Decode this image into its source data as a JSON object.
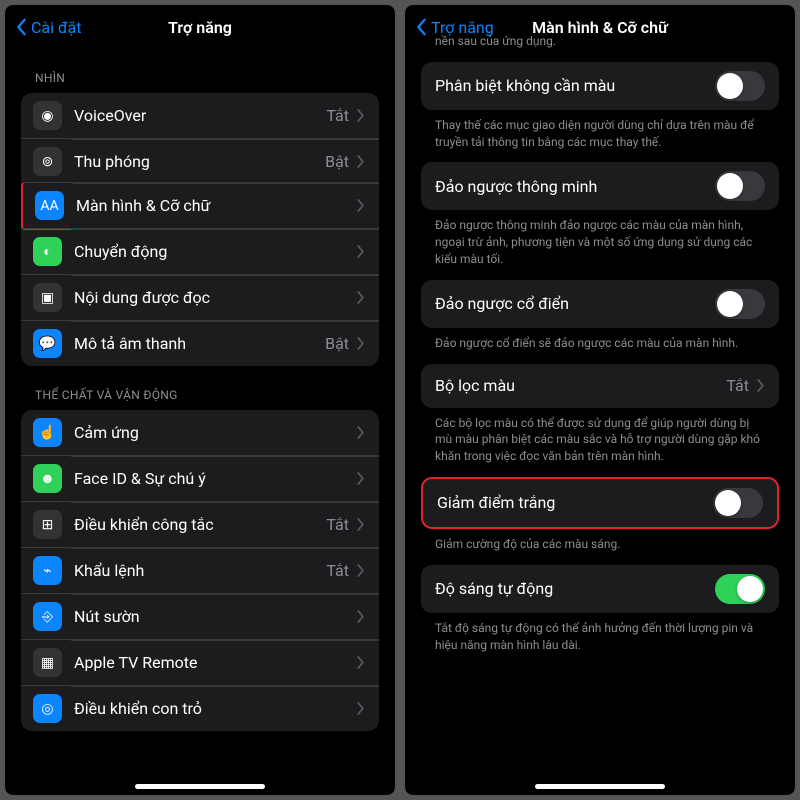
{
  "left": {
    "back": "Cài đặt",
    "title": "Trợ năng",
    "section1": "NHÌN",
    "items1": [
      {
        "label": "VoiceOver",
        "value": "Tắt",
        "iconColor": "#333"
      },
      {
        "label": "Thu phóng",
        "value": "Bật",
        "iconColor": "#333"
      },
      {
        "label": "Màn hình & Cỡ chữ",
        "value": "",
        "iconColor": "#0A84FF",
        "hl": true
      },
      {
        "label": "Chuyển động",
        "value": "",
        "iconColor": "#30D158"
      },
      {
        "label": "Nội dung được đọc",
        "value": "",
        "iconColor": "#333"
      },
      {
        "label": "Mô tả âm thanh",
        "value": "Bật",
        "iconColor": "#0A84FF"
      }
    ],
    "section2": "THỂ CHẤT VÀ VẬN ĐỘNG",
    "items2": [
      {
        "label": "Cảm ứng",
        "value": "",
        "iconColor": "#0A84FF"
      },
      {
        "label": "Face ID & Sự chú ý",
        "value": "",
        "iconColor": "#30D158"
      },
      {
        "label": "Điều khiển công tắc",
        "value": "Tắt",
        "iconColor": "#333"
      },
      {
        "label": "Khẩu lệnh",
        "value": "Tắt",
        "iconColor": "#0A84FF"
      },
      {
        "label": "Nút sườn",
        "value": "",
        "iconColor": "#0A84FF"
      },
      {
        "label": "Apple TV Remote",
        "value": "",
        "iconColor": "#333"
      },
      {
        "label": "Điều khiển con trỏ",
        "value": "",
        "iconColor": "#0A84FF"
      }
    ]
  },
  "right": {
    "back": "Trợ năng",
    "title": "Màn hình & Cỡ chữ",
    "top_note": "nền sau của ứng dụng.",
    "rows": [
      {
        "label": "Phân biệt không cần màu",
        "on": false,
        "footer": "Thay thế các mục giao diện người dùng chỉ dựa trên màu để truyền tải thông tin bằng các mục thay thế."
      },
      {
        "label": "Đảo ngược thông minh",
        "on": false,
        "footer": "Đảo ngược thông minh đảo ngược các màu của màn hình, ngoại trừ ảnh, phương tiện và một số ứng dụng sử dụng các kiểu màu tối."
      },
      {
        "label": "Đảo ngược cổ điển",
        "on": false,
        "footer": "Đảo ngược cổ điển sẽ đảo ngược các màu của màn hình."
      },
      {
        "label": "Bộ lọc màu",
        "value": "Tắt",
        "nav": true,
        "footer": "Các bộ lọc màu có thể được sử dụng để giúp người dùng bị mù màu phân biệt các màu sắc và hỗ trợ người dùng gặp khó khăn trong việc đọc văn bản trên màn hình."
      },
      {
        "label": "Giảm điểm trắng",
        "on": false,
        "hl": true,
        "footer": "Giảm cường độ của các màu sáng."
      },
      {
        "label": "Độ sáng tự động",
        "on": true,
        "footer": "Tắt độ sáng tự động có thể ảnh hưởng đến thời lượng pin và hiệu năng màn hình lâu dài."
      }
    ]
  }
}
